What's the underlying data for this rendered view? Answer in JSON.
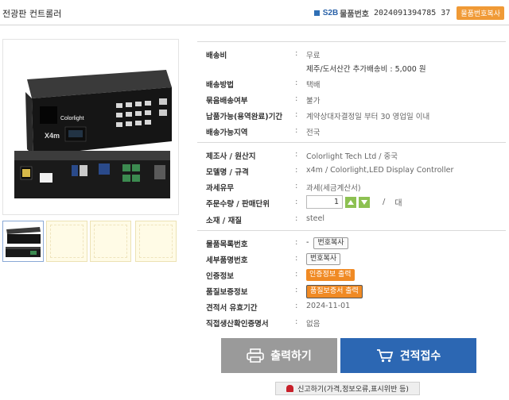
{
  "header": {
    "title": "전광판 컨트롤러",
    "s2b_logo": "S2B",
    "product_no_label": "물품번호",
    "product_no": "2024091394785 37",
    "copy_button": "물품번호복사"
  },
  "groups": {
    "shipping": [
      {
        "label": "배송비",
        "value": "무료",
        "sub": "제주/도서산간 추가배송비 : 5,000 원"
      },
      {
        "label": "배송방법",
        "value": "택배"
      },
      {
        "label": "묶음배송여부",
        "value": "불가"
      },
      {
        "label": "납품가능(용역완료)기간",
        "value": "계약상대자결정일 부터 30 영업일 이내"
      },
      {
        "label": "배송가능지역",
        "value": "전국"
      }
    ],
    "product": [
      {
        "label": "제조사 / 원산지",
        "value": "Colorlight Tech Ltd / 중국"
      },
      {
        "label": "모델명 / 규격",
        "value": "x4m / Colorlight,LED Display Controller"
      },
      {
        "label": "과세유무",
        "value": "과세(세금계산서)"
      },
      {
        "label": "주문수량 / 판매단위",
        "qty": "1",
        "slash": "/",
        "unit": "대"
      },
      {
        "label": "소재 / 재질",
        "value": "steel"
      }
    ],
    "cert": [
      {
        "label": "물품목록번호",
        "value": "-",
        "button": "번호복사"
      },
      {
        "label": "세부품명번호",
        "button": "번호복사"
      },
      {
        "label": "인증정보",
        "button": "인증정보 출력"
      },
      {
        "label": "품질보증정보",
        "button": "품질보증서 출력"
      },
      {
        "label": "견적서 유효기간",
        "value": "2024-11-01"
      },
      {
        "label": "직접생산확인증명서",
        "value": "없음"
      }
    ]
  },
  "actions": {
    "print": "출력하기",
    "quote": "견적접수",
    "report": "신고하기(가격,정보오류,표시위반 등)"
  },
  "device": {
    "brand": "Colorlight",
    "model": "X4m"
  },
  "colors": {
    "accent_orange": "#f09a36",
    "quote_blue": "#2c67b3",
    "print_gray": "#9a9a9a",
    "qty_green": "#8dc152"
  }
}
